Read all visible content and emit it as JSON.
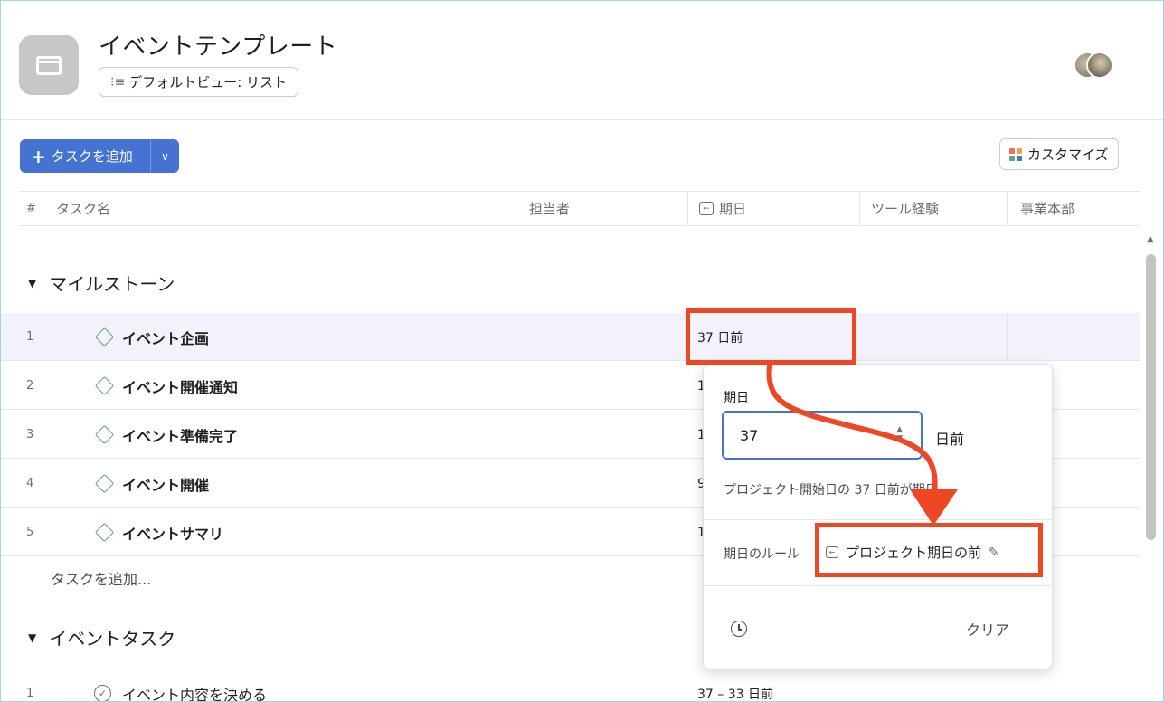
{
  "project": {
    "title": "イベントテンプレート",
    "default_view_label": "デフォルトビュー: リスト"
  },
  "toolbar": {
    "add_task_label": "タスクを追加",
    "customize_label": "カスタマイズ"
  },
  "columns": {
    "hash": "#",
    "task_name": "タスク名",
    "assignee": "担当者",
    "due_date": "期日",
    "tool_experience": "ツール経験",
    "division": "事業本部"
  },
  "sections": [
    {
      "title": "マイルストーン",
      "rows": [
        {
          "num": "1",
          "name": "イベント企画",
          "due": "37 日前"
        },
        {
          "num": "2",
          "name": "イベント開催通知",
          "due": "1"
        },
        {
          "num": "3",
          "name": "イベント準備完了",
          "due": "1"
        },
        {
          "num": "4",
          "name": "イベント開催",
          "due": "9"
        },
        {
          "num": "5",
          "name": "イベントサマリ",
          "due": "1"
        }
      ],
      "add_task_link": "タスクを追加..."
    },
    {
      "title": "イベントタスク",
      "rows": [
        {
          "num": "1",
          "name": "イベント内容を決める",
          "due": "37 – 33 日前"
        }
      ]
    }
  ],
  "popover": {
    "label": "期日",
    "input_value": "37",
    "unit": "日前",
    "description": "プロジェクト開始日の 37 日前が期日",
    "rule_label": "期日のルール",
    "rule_value": "プロジェクト期日の前",
    "clear_label": "クリア"
  },
  "colors": {
    "accent": "#4573d2",
    "highlight": "#ef4723",
    "milestone": "#58a182"
  }
}
